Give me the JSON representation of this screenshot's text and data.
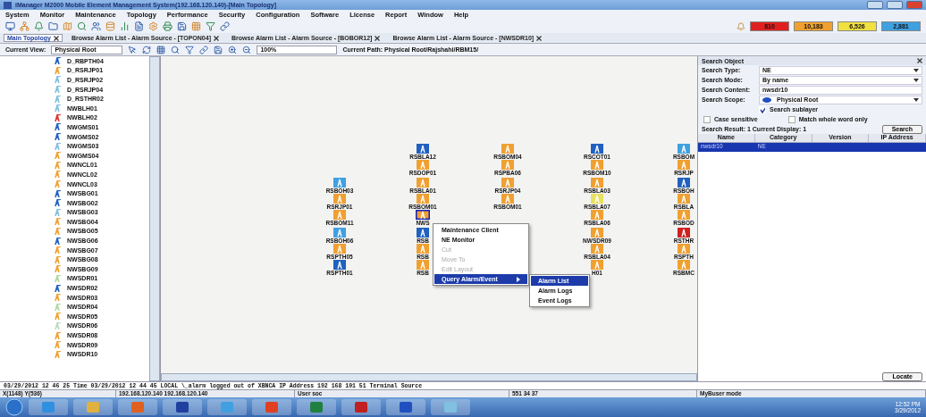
{
  "window": {
    "title": "iManager M2000 Mobile Element Management System(192.168.120.140)-[Main Topology]"
  },
  "menu": [
    "System",
    "Monitor",
    "Maintenance",
    "Topology",
    "Performance",
    "Security",
    "Configuration",
    "Software",
    "License",
    "Report",
    "Window",
    "Help"
  ],
  "alarm_counts": [
    {
      "value": "810",
      "color": "#e02020"
    },
    {
      "value": "10,183",
      "color": "#f0a030"
    },
    {
      "value": "6,526",
      "color": "#f0e040"
    },
    {
      "value": "2,881",
      "color": "#40a0e0"
    }
  ],
  "tabs": [
    {
      "label": "Main Topology",
      "selected": true
    },
    {
      "label": "Browse Alarm List - Alarm Source - [TOPON04]",
      "selected": false
    },
    {
      "label": "Browse Alarm List - Alarm Source - [BOBOR12]",
      "selected": false
    },
    {
      "label": "Browse Alarm List - Alarm Source - [NWSDR10]",
      "selected": false
    }
  ],
  "view_bar": {
    "label": "Current View:",
    "view": "Physical Root",
    "zoom": "100%",
    "path": "Current Path: Physical Root/Rajshahi/RBM15/"
  },
  "tree": {
    "items": [
      {
        "label": "D_RBPTH04",
        "color": "#2060c0"
      },
      {
        "label": "D_RSRJP01",
        "color": "#f0a030"
      },
      {
        "label": "D_RSRJP02",
        "color": "#80c0e0"
      },
      {
        "label": "D_RSRJP04",
        "color": "#80c0e0"
      },
      {
        "label": "D_RSTHR02",
        "color": "#80c0e0"
      },
      {
        "label": "NWBLH01",
        "color": "#80c0e0"
      },
      {
        "label": "NWBLH02",
        "color": "#e03030"
      },
      {
        "label": "NWGMS01",
        "color": "#2060c0"
      },
      {
        "label": "NWGMS02",
        "color": "#2060c0"
      },
      {
        "label": "NWGMS03",
        "color": "#80c0e0"
      },
      {
        "label": "NWGMS04",
        "color": "#f0a030"
      },
      {
        "label": "NWNCL01",
        "color": "#f0a030"
      },
      {
        "label": "NWNCL02",
        "color": "#f0a030"
      },
      {
        "label": "NWNCL03",
        "color": "#f0a030"
      },
      {
        "label": "NWSBG01",
        "color": "#2060c0"
      },
      {
        "label": "NWSBG02",
        "color": "#2060c0"
      },
      {
        "label": "NWSBG03",
        "color": "#80c0e0"
      },
      {
        "label": "NWSBG04",
        "color": "#f0a030"
      },
      {
        "label": "NWSBG05",
        "color": "#f0a030"
      },
      {
        "label": "NWSBG06",
        "color": "#2060c0"
      },
      {
        "label": "NWSBG07",
        "color": "#f0a030"
      },
      {
        "label": "NWSBG08",
        "color": "#f0a030"
      },
      {
        "label": "NWSBG09",
        "color": "#f0a030"
      },
      {
        "label": "NWSDR01",
        "color": "#b0d8a0"
      },
      {
        "label": "NWSDR02",
        "color": "#2060c0"
      },
      {
        "label": "NWSDR03",
        "color": "#f0a030"
      },
      {
        "label": "NWSDR04",
        "color": "#b0d8a0"
      },
      {
        "label": "NWSDR05",
        "color": "#f0a030"
      },
      {
        "label": "NWSDR06",
        "color": "#c0d8c0"
      },
      {
        "label": "NWSDR08",
        "color": "#f0a030"
      },
      {
        "label": "NWSDR09",
        "color": "#f0a030"
      },
      {
        "label": "NWSDR10",
        "color": "#f0a030"
      }
    ]
  },
  "topology": {
    "columns": [
      {
        "nodes": [
          {
            "label": "RSBOH03",
            "color": "#40a0e0",
            "selected": false
          },
          {
            "label": "RSRJP01",
            "color": "#f0a030",
            "selected": false
          },
          {
            "label": "RSBOM11",
            "color": "#f0a030",
            "selected": false
          },
          {
            "label": "RSBOH06",
            "color": "#40a0e0",
            "selected": false
          },
          {
            "label": "RSPTH05",
            "color": "#f0a030",
            "selected": false
          },
          {
            "label": "RSPTH01",
            "color": "#2060c0",
            "selected": false
          }
        ]
      },
      {
        "nodes": [
          {
            "label": "RSBLA12",
            "color": "#2060c0",
            "selected": false
          },
          {
            "label": "RSDOP01",
            "color": "#f0a030",
            "selected": false
          },
          {
            "label": "RSBLA01",
            "color": "#f0a030",
            "selected": false
          },
          {
            "label": "RSBOM01",
            "color": "#f0a030",
            "selected": false
          },
          {
            "label": "NWS",
            "color": "#f0a030",
            "selected": true
          },
          {
            "label": "RSB",
            "color": "#2060c0",
            "selected": false
          },
          {
            "label": "RSB",
            "color": "#f0a030",
            "selected": false
          },
          {
            "label": "RSB",
            "color": "#f0a030",
            "selected": false
          }
        ]
      },
      {
        "nodes": [
          {
            "label": "RSBOM04",
            "color": "#f0a030",
            "selected": false
          },
          {
            "label": "RSPBA06",
            "color": "#f0a030",
            "selected": false
          },
          {
            "label": "RSRJP04",
            "color": "#f0a030",
            "selected": false
          },
          {
            "label": "RSBOM01",
            "color": "#f0a030",
            "selected": false
          }
        ]
      },
      {
        "nodes": [
          {
            "label": "RSCOT01",
            "color": "#2060c0",
            "selected": false
          },
          {
            "label": "RSBOM10",
            "color": "#f0a030",
            "selected": false
          },
          {
            "label": "RSBLA03",
            "color": "#f0a030",
            "selected": false
          },
          {
            "label": "RSBLA07",
            "color": "#e8e060",
            "selected": false
          },
          {
            "label": "RSBLA06",
            "color": "#f0a030",
            "selected": false
          },
          {
            "label": "NWSDR09",
            "color": "#f0a030",
            "selected": false
          },
          {
            "label": "RSBLA04",
            "color": "#f0a030",
            "selected": false
          },
          {
            "label": "H01",
            "color": "#f0a030",
            "selected": false
          }
        ]
      },
      {
        "nodes": [
          {
            "label": "RSBOM",
            "color": "#40a0e0",
            "selected": false
          },
          {
            "label": "RSRJP",
            "color": "#f0a030",
            "selected": false
          },
          {
            "label": "RSBOH",
            "color": "#2060c0",
            "selected": false
          },
          {
            "label": "RSBLA",
            "color": "#f0a030",
            "selected": false
          },
          {
            "label": "RSBOD",
            "color": "#f0a030",
            "selected": false
          },
          {
            "label": "RSTHR",
            "color": "#d02020",
            "selected": false
          },
          {
            "label": "RSPTH",
            "color": "#f0a030",
            "selected": false
          },
          {
            "label": "RSBMC",
            "color": "#f0a030",
            "selected": false
          }
        ]
      }
    ]
  },
  "context_menu": {
    "items": [
      {
        "label": "Maintenance Client",
        "disabled": false,
        "selected": false,
        "submenu": false
      },
      {
        "label": "NE Monitor",
        "disabled": false,
        "selected": false,
        "submenu": false
      },
      {
        "label": "Cut",
        "disabled": true,
        "selected": false,
        "submenu": false
      },
      {
        "label": "Move To",
        "disabled": true,
        "selected": false,
        "submenu": false
      },
      {
        "label": "Edit Layout",
        "disabled": true,
        "selected": false,
        "submenu": false
      },
      {
        "label": "Query Alarm/Event",
        "disabled": false,
        "selected": true,
        "submenu": true
      }
    ],
    "submenu": [
      {
        "label": "Alarm List",
        "selected": true
      },
      {
        "label": "Alarm Logs",
        "selected": false
      },
      {
        "label": "Event Logs",
        "selected": false
      }
    ]
  },
  "search_panel": {
    "title": "Search Object",
    "fields": [
      {
        "label": "Search Type:",
        "value": "NE",
        "kind": "select"
      },
      {
        "label": "Search Mode:",
        "value": "By name",
        "kind": "select"
      },
      {
        "label": "Search Content:",
        "value": "nwsdr10",
        "kind": "text"
      },
      {
        "label": "Search Scope:",
        "value": "Physical Root",
        "kind": "scope"
      }
    ],
    "sublayer": {
      "label": "Search sublayer",
      "checked": true
    },
    "options": [
      {
        "label": "Case sensitive",
        "checked": false
      },
      {
        "label": "Match whole word only",
        "checked": false
      }
    ],
    "result": "Search Result: 1 Current Display: 1",
    "search_button": "Search",
    "columns": [
      "Name",
      "Category",
      "Version",
      "IP Address"
    ],
    "rows": [
      {
        "cells": [
          "nwsdr10",
          "NE"
        ],
        "selected": true
      }
    ],
    "locate_button": "Locate"
  },
  "status_bar": {
    "message": "03/29/2012 12 46 25   Time 03/29/2012 12 44 45   LOCAL \\_alarm logged out of XBNCA   IP Address 192 168 101 51   Terminal Source",
    "fields": [
      "X(1148) Y(536)",
      "192.168.120.140 192.168.120.140",
      "User soc",
      "551 34 37",
      "MyBuser mode"
    ]
  },
  "taskbar": {
    "time": "12:52 PM",
    "date": "3/29/2012"
  }
}
